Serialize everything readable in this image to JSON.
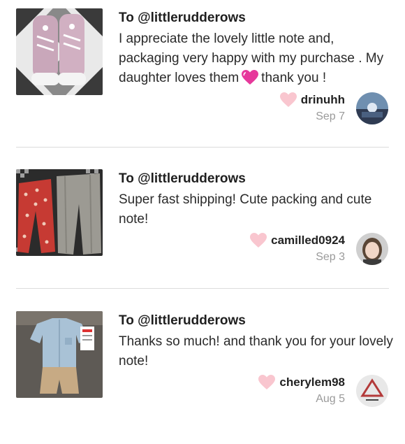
{
  "reviews": [
    {
      "to": "To @littlerudderows",
      "message_part1": "I appreciate the lovely little note and, packaging very happy with my purchase . My daughter loves them",
      "message_part2": "thank you !",
      "username": "drinuhh",
      "date": "Sep 7",
      "thumb_icon": "pink-high-top-sneakers",
      "avatar_icon": "fountain-photo"
    },
    {
      "to": "To @littlerudderows",
      "message": "Super fast shipping! Cute packing and cute note!",
      "username": "camilled0924",
      "date": "Sep 3",
      "thumb_icon": "red-pants-and-jeans",
      "avatar_icon": "woman-portrait"
    },
    {
      "to": "To @littlerudderows",
      "message": "Thanks so much! and thank you for your lovely note!",
      "username": "cherylem98",
      "date": "Aug 5",
      "thumb_icon": "boys-shirt-and-shorts",
      "avatar_icon": "logo-avatar"
    }
  ],
  "colors": {
    "heart": "#f9c6cf",
    "emoji_heart": "#e6399b",
    "date": "#9a9a9a",
    "divider": "#dcdcdc"
  }
}
